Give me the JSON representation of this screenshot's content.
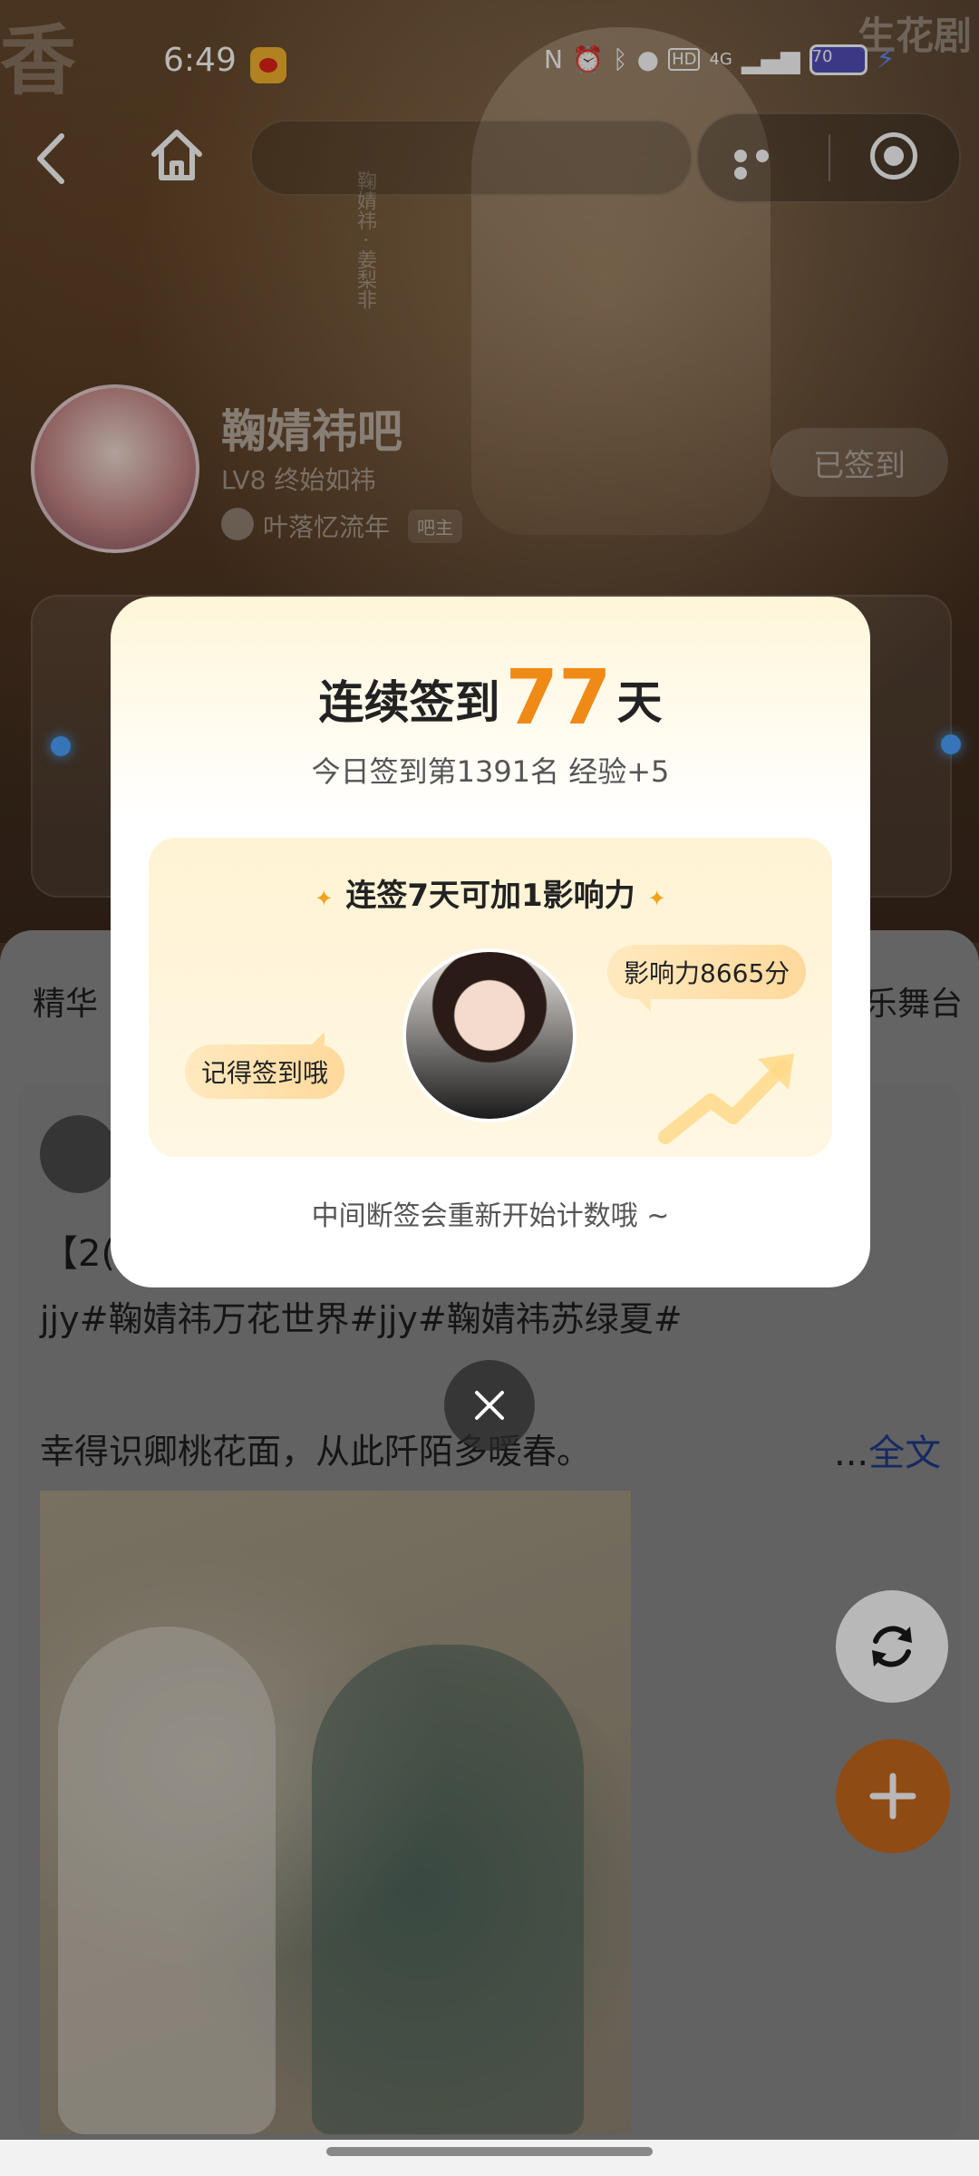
{
  "status_bar": {
    "time": "6:49",
    "network": "4G",
    "battery": "70",
    "icons": [
      "nfc-icon",
      "alarm-icon",
      "bluetooth-icon",
      "location-icon",
      "hd-icon",
      "signal-icon",
      "battery-icon",
      "charging-icon"
    ]
  },
  "top_bar": {
    "icons": [
      "back-icon",
      "home-icon",
      "more-icon",
      "target-icon"
    ]
  },
  "background": {
    "vertical_caption": "鞠婧祎 · 姜梨非",
    "corner_watermark": "生花剧"
  },
  "forum": {
    "name": "鞠婧祎吧",
    "level": "LV8 终始如祎",
    "owner_name": "叶落忆流年",
    "owner_badge": "吧主",
    "signed_label": "已签到"
  },
  "tabs": {
    "left": "精华",
    "right": "乐舞台"
  },
  "post": {
    "prefix": "【2(",
    "tags": "jjy#鞠婧祎万花世界#jjy#鞠婧祎苏绿夏#",
    "body": "幸得识卿桃花面，从此阡陌多暖春。",
    "ellipsis": "...",
    "read_more": "全文"
  },
  "modal": {
    "streak_prefix": "连续签到",
    "streak_days": "77",
    "streak_suffix": "天",
    "rank_line": "今日签到第1391名 经验+5",
    "promo_title": "连签7天可加1影响力",
    "bubble_left": "记得签到哦",
    "bubble_right": "影响力8665分",
    "reset_note": "中间断签会重新开始计数哦 ~"
  },
  "colors": {
    "streak_accent": "#f08a17",
    "fab_orange": "#c7681d",
    "link_blue": "#1f3a8a"
  }
}
